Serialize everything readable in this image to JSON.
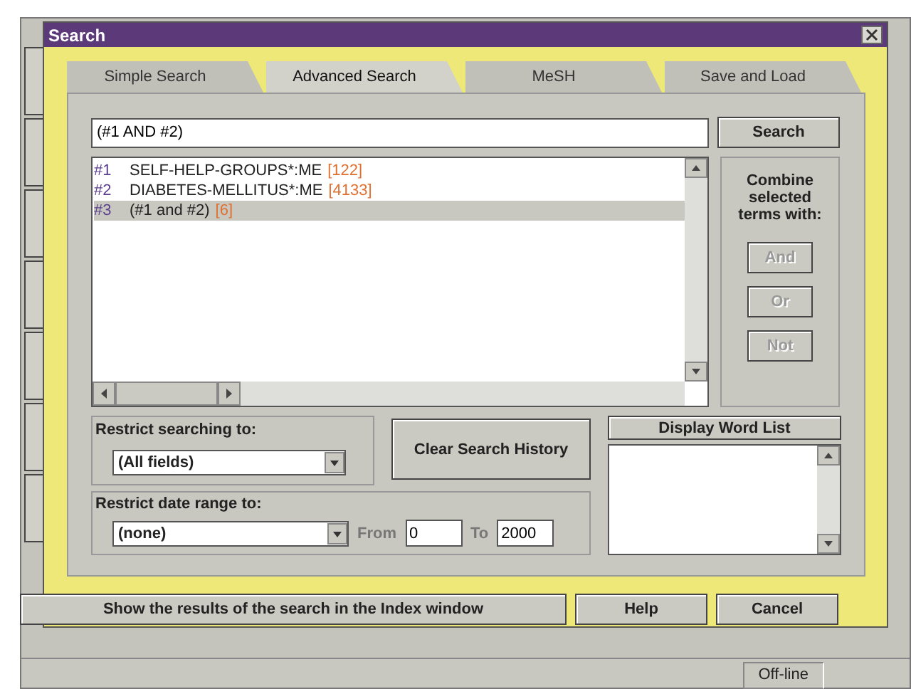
{
  "window": {
    "title": "Search"
  },
  "tabs": [
    {
      "label": "Simple Search",
      "selected": false
    },
    {
      "label": "Advanced Search",
      "selected": true
    },
    {
      "label": "MeSH",
      "selected": false
    },
    {
      "label": "Save and Load",
      "selected": false
    }
  ],
  "query": {
    "value": "(#1 AND #2)"
  },
  "search_button": "Search",
  "history": [
    {
      "number": "#1",
      "term": "SELF-HELP-GROUPS*:ME",
      "count": "[122]",
      "selected": false
    },
    {
      "number": "#2",
      "term": "DIABETES-MELLITUS*:ME",
      "count": "[4133]",
      "selected": false
    },
    {
      "number": "#3",
      "term": "(#1 and #2)",
      "count": "[6]",
      "selected": true
    }
  ],
  "combine": {
    "label": "Combine selected terms with:",
    "buttons": [
      {
        "label": "And",
        "disabled": true
      },
      {
        "label": "Or",
        "disabled": true
      },
      {
        "label": "Not",
        "disabled": true
      }
    ]
  },
  "restrict_fields": {
    "label": "Restrict searching to:",
    "value": "(All fields)"
  },
  "clear_button": "Clear Search History",
  "word_list_button": "Display Word List",
  "restrict_dates": {
    "label": "Restrict date range to:",
    "value": "(none)",
    "from_label": "From",
    "from": "0",
    "to_label": "To",
    "to": "2000"
  },
  "buttons": [
    "Show the results of the search in the Index window",
    "Help",
    "Cancel"
  ],
  "status_bar": {
    "connection": "Off-line"
  }
}
